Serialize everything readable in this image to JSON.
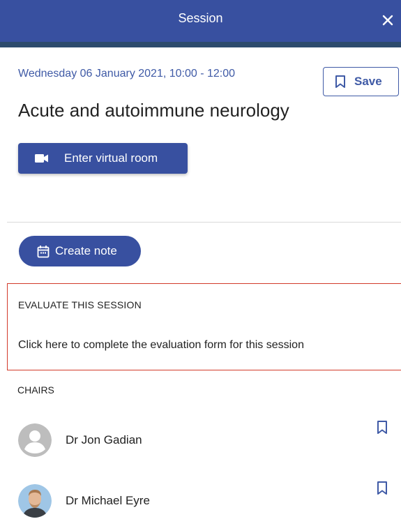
{
  "header": {
    "title": "Session",
    "close_icon": "close-icon"
  },
  "session": {
    "datetime": "Wednesday 06 January 2021, 10:00 - 12:00",
    "title": "Acute and autoimmune neurology",
    "save_label": "Save",
    "virtual_room_label": "Enter virtual room",
    "create_note_label": "Create note"
  },
  "evaluate": {
    "heading": "EVALUATE THIS SESSION",
    "link_text": "Click here to complete the evaluation form for this session"
  },
  "chairs": {
    "heading": "CHAIRS",
    "items": [
      {
        "name": "Dr Jon Gadian",
        "avatar": "default-avatar-icon"
      },
      {
        "name": "Dr Michael Eyre",
        "avatar": "photo-avatar"
      }
    ]
  },
  "colors": {
    "primary": "#3850a0",
    "accent_text": "#3f5aa6",
    "highlight_border": "#d23a2a"
  }
}
